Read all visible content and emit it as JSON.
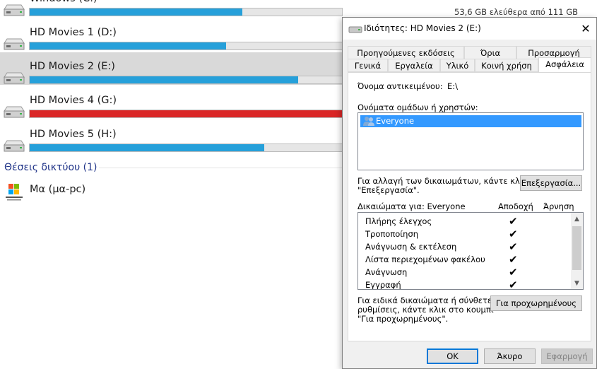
{
  "explorer": {
    "drives": [
      {
        "name": "Windows (C:)",
        "fill_pct": 68,
        "free_text": "53,6 GB ελεύθερα από 111 GB",
        "status": "normal",
        "selected": false
      },
      {
        "name": "HD Movies 1 (D:)",
        "fill_pct": 63,
        "free_text": "",
        "status": "normal",
        "selected": false
      },
      {
        "name": "HD Movies 2 (E:)",
        "fill_pct": 86,
        "free_text": "",
        "status": "normal",
        "selected": true
      },
      {
        "name": "HD Movies 4 (G:)",
        "fill_pct": 100,
        "free_text": "",
        "status": "full",
        "selected": false
      },
      {
        "name": "HD Movies 5 (H:)",
        "fill_pct": 75,
        "free_text": "",
        "status": "normal",
        "selected": false
      }
    ],
    "network_section": "Θέσεις δικτύου (1)",
    "network_items": [
      {
        "name": "Μα (μα-pc)",
        "icon": "windows-media-player-icon"
      }
    ]
  },
  "dialog": {
    "title": "Ιδιότητες: HD Movies 2 (E:)",
    "tabs_row1": [
      "Προηγούμενες εκδόσεις",
      "Όρια",
      "Προσαρμογή"
    ],
    "tabs_row2": [
      "Γενικά",
      "Εργαλεία",
      "Υλικό",
      "Κοινή χρήση",
      "Ασφάλεια"
    ],
    "active_tab": "Ασφάλεια",
    "object_name_label": "Όνομα αντικειμένου:",
    "object_name_value": "E:\\",
    "groups_label": "Ονόματα ομάδων ή χρηστών:",
    "groups": [
      "Everyone"
    ],
    "change_text_1": "Για αλλαγή των δικαιωμάτων, κάντε κλικ στο κουμπί",
    "change_text_2": "\"Επεξεργασία\".",
    "edit_button": "Επεξεργασία...",
    "permissions_label": "Δικαιώματα για: Everyone",
    "allow_header": "Αποδοχή",
    "deny_header": "Άρνηση",
    "permissions": [
      {
        "name": "Πλήρης έλεγχος",
        "allow": true,
        "deny": false
      },
      {
        "name": "Τροποποίηση",
        "allow": true,
        "deny": false
      },
      {
        "name": "Ανάγνωση & εκτέλεση",
        "allow": true,
        "deny": false
      },
      {
        "name": "Λίστα περιεχομένων φακέλου",
        "allow": true,
        "deny": false
      },
      {
        "name": "Ανάγνωση",
        "allow": true,
        "deny": false
      },
      {
        "name": "Εγγραφή",
        "allow": true,
        "deny": false
      }
    ],
    "special_text_1": "Για ειδικά δικαιώματα ή σύνθετες",
    "special_text_2": "ρυθμίσεις, κάντε κλικ στο κουμπί",
    "special_text_3": "\"Για προχωρημένους\".",
    "advanced_button": "Για προχωρημένους",
    "ok_button": "OK",
    "cancel_button": "Άκυρο",
    "apply_button": "Εφαρμογή"
  },
  "colors": {
    "bar_normal": "#26a0da",
    "bar_full": "#da2626",
    "selection": "#3399ff"
  }
}
